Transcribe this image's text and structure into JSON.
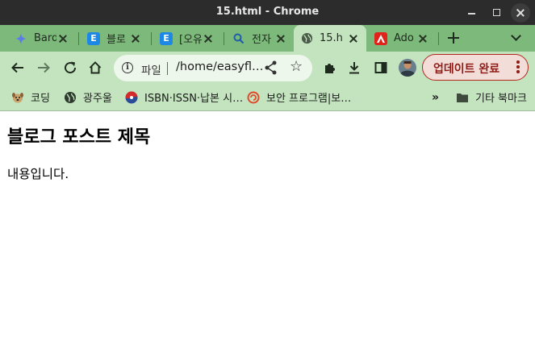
{
  "window": {
    "title": "15.html - Chrome"
  },
  "tabs": [
    {
      "label": "Bard",
      "icon": "bard-sparkle-icon"
    },
    {
      "label": "블로",
      "icon": "easyflow-blog-icon"
    },
    {
      "label": "[오유",
      "icon": "easyflow-blog-icon"
    },
    {
      "label": "전자",
      "icon": "search-icon"
    },
    {
      "label": "15.h",
      "icon": "globe-icon",
      "active": true
    },
    {
      "label": "Ado",
      "icon": "adobe-icon"
    }
  ],
  "toolbar": {
    "scheme_label": "파일",
    "url": "/home/easyfl…",
    "update_label": "업데이트 완료"
  },
  "bookmarks": [
    {
      "label": "코딩",
      "icon": "dog-icon"
    },
    {
      "label": "광주울",
      "icon": "globe-icon"
    },
    {
      "label": "ISBN·ISSN·납본 시…",
      "icon": "korea-emblem-icon"
    },
    {
      "label": "보안 프로그램|보…",
      "icon": "shield-swirl-icon"
    }
  ],
  "bookmarks_other": {
    "label": "기타 북마크",
    "icon": "folder-icon"
  },
  "page": {
    "heading": "블로그 포스트 제목",
    "body": "내용입니다."
  },
  "colors": {
    "titlebar": "#2c2c2c",
    "tabstrip": "#7cb97a",
    "toolbar": "#c3e4bf",
    "update_accent": "#b3261e"
  }
}
